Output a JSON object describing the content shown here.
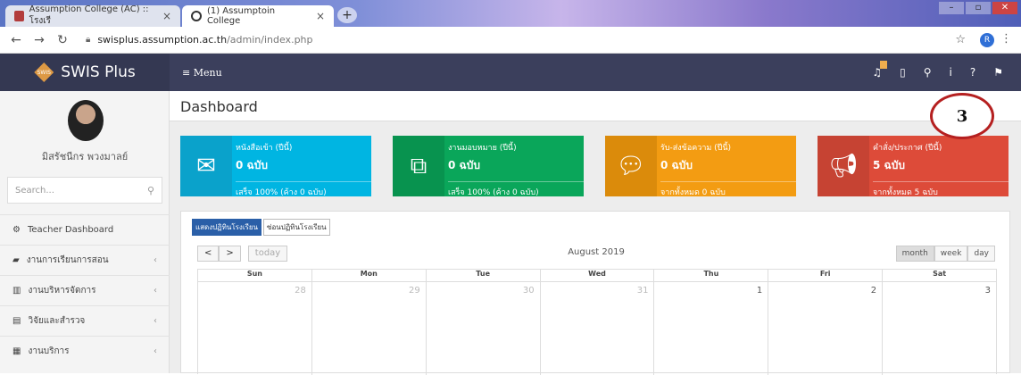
{
  "browser": {
    "tabs": [
      {
        "title": "Assumption College (AC) :: โรงเรี"
      },
      {
        "title": "(1) Assumptoin College"
      }
    ],
    "url_host": "swisplus.assumption.ac.th",
    "url_path": "/admin/index.php",
    "profile_initial": "R"
  },
  "app": {
    "brand": "SWIS Plus",
    "menu_label": "≡ Menu",
    "user_name": "มิสรัชนีกร พวงมาลย์",
    "search_placeholder": "Search...",
    "page_title": "Dashboard",
    "sidebar_items": [
      {
        "label": "Teacher Dashboard",
        "icon": "dashboard-icon"
      },
      {
        "label": "งานการเรียนการสอน",
        "icon": "graduation-cap-icon"
      },
      {
        "label": "งานบริหารจัดการ",
        "icon": "bank-icon"
      },
      {
        "label": "วิจัยและสำรวจ",
        "icon": "clipboard-icon"
      },
      {
        "label": "งานบริการ",
        "icon": "book-icon"
      }
    ],
    "info_boxes": [
      {
        "label": "หนังสือเข้า (ปีนี้)",
        "value": "0 ฉบับ",
        "footer": "เสร็จ 100% (ค้าง 0 ฉบับ)",
        "color": "#00b5e2",
        "icon": "envelope-icon"
      },
      {
        "label": "งานมอบหมาย (ปีนี้)",
        "value": "0 ฉบับ",
        "footer": "เสร็จ 100% (ค้าง 0 ฉบับ)",
        "color": "#0aa65a",
        "icon": "copy-icon"
      },
      {
        "label": "รับ-ส่งข้อความ (ปีนี้)",
        "value": "0 ฉบับ",
        "footer": "จากทั้งหมด 0 ฉบับ",
        "color": "#f39c12",
        "icon": "comment-icon"
      },
      {
        "label": "คำสั่ง/ประกาศ (ปีนี้)",
        "value": "5 ฉบับ",
        "footer": "จากทั้งหมด 5 ฉบับ",
        "color": "#dd4b39",
        "icon": "megaphone-icon"
      }
    ],
    "calendar": {
      "tabs": [
        "แสดงปฏิทินโรงเรียน",
        "ซ่อนปฏิทินโรงเรียน"
      ],
      "prev": "<",
      "next": ">",
      "today": "today",
      "month_title": "August 2019",
      "views": [
        "month",
        "week",
        "day"
      ],
      "weekdays": [
        "Sun",
        "Mon",
        "Tue",
        "Wed",
        "Thu",
        "Fri",
        "Sat"
      ],
      "first_row": [
        "28",
        "29",
        "30",
        "31",
        "1",
        "2",
        "3"
      ]
    },
    "annotation": "3"
  }
}
